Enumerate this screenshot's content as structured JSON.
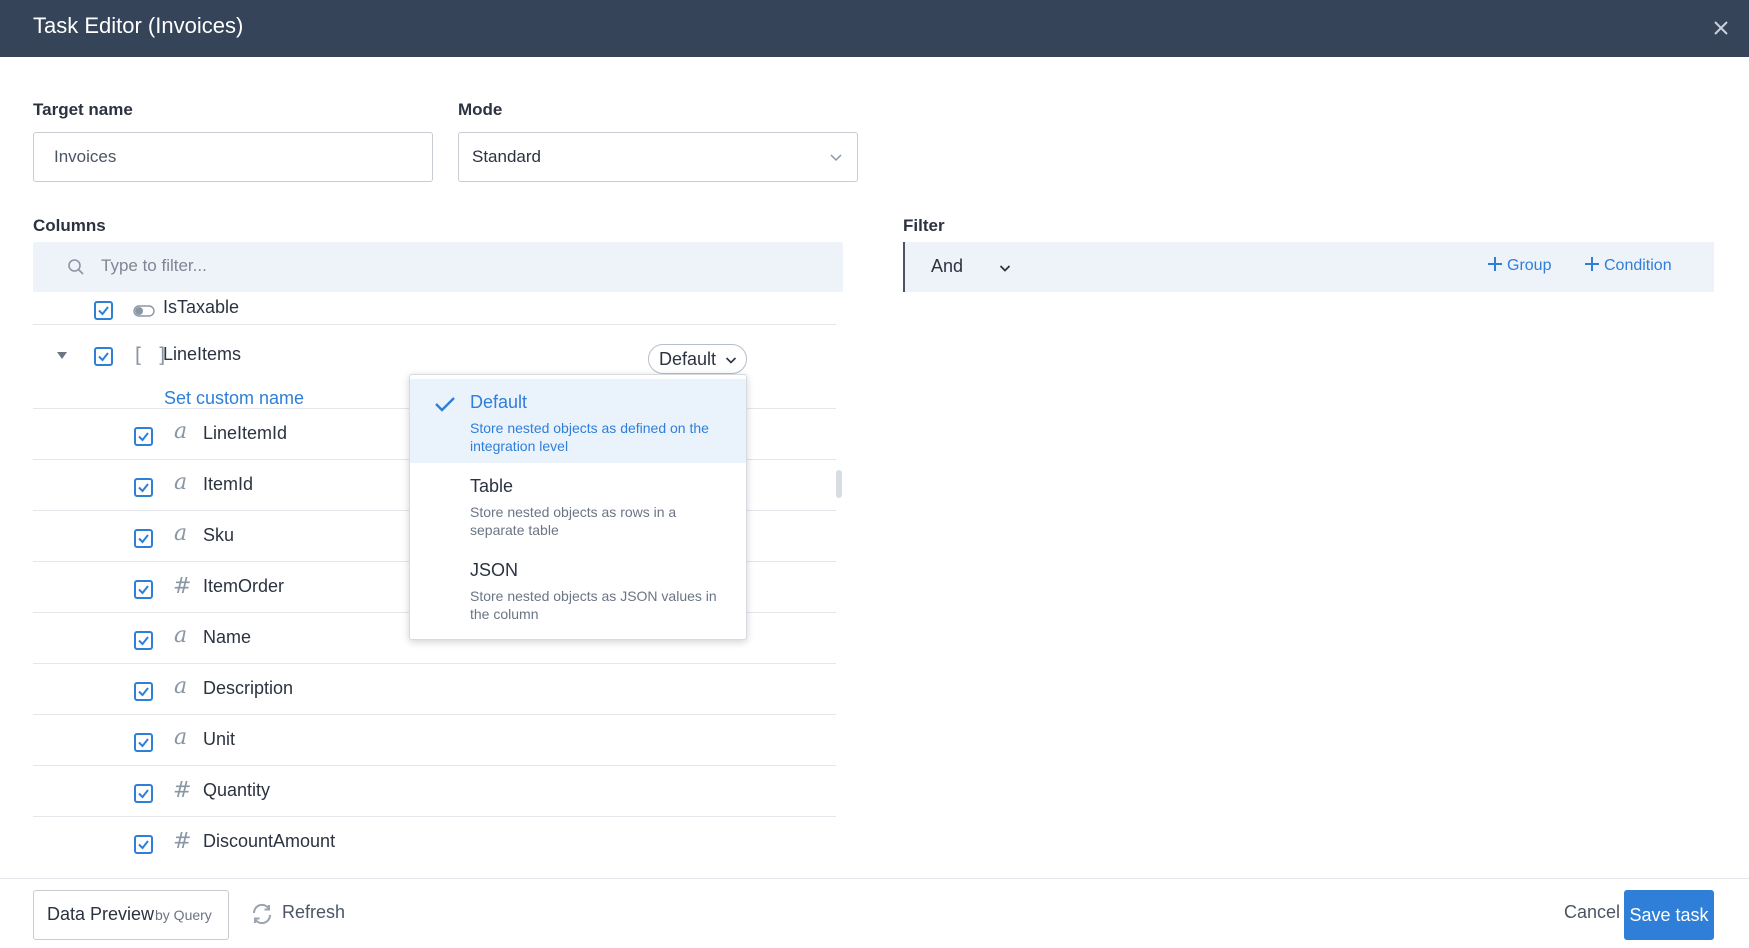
{
  "window": {
    "title": "Task Editor (Invoices)"
  },
  "target": {
    "label": "Target name",
    "value": "Invoices"
  },
  "mode": {
    "label": "Mode",
    "value": "Standard"
  },
  "columns": {
    "label": "Columns",
    "filter_placeholder": "Type to filter...",
    "rows": [
      {
        "name": "IsTaxable",
        "type": "boolean-icon",
        "checked": true
      },
      {
        "name": "LineItems",
        "type": "array-icon",
        "checked": true,
        "expanded": true,
        "mode": "Default",
        "custom_name_link": "Set custom name"
      },
      {
        "name": "LineItemId",
        "type": "text-icon",
        "checked": true
      },
      {
        "name": "ItemId",
        "type": "text-icon",
        "checked": true
      },
      {
        "name": "Sku",
        "type": "text-icon",
        "checked": true
      },
      {
        "name": "ItemOrder",
        "type": "number-icon",
        "checked": true
      },
      {
        "name": "Name",
        "type": "text-icon",
        "checked": true
      },
      {
        "name": "Description",
        "type": "text-icon",
        "checked": true
      },
      {
        "name": "Unit",
        "type": "text-icon",
        "checked": true
      },
      {
        "name": "Quantity",
        "type": "number-icon",
        "checked": true
      },
      {
        "name": "DiscountAmount",
        "type": "number-icon",
        "checked": true
      }
    ]
  },
  "nested_mode_dropdown": {
    "options": [
      {
        "name": "Default",
        "desc": "Store nested objects as defined on the integration level",
        "selected": true
      },
      {
        "name": "Table",
        "desc": "Store nested objects as rows in a separate table",
        "selected": false
      },
      {
        "name": "JSON",
        "desc": "Store nested objects as JSON values in the column",
        "selected": false
      }
    ]
  },
  "filter": {
    "label": "Filter",
    "operator": "And",
    "add_group": "Group",
    "add_condition": "Condition"
  },
  "footer": {
    "data_preview": "Data Preview",
    "data_preview_sub": "by Query",
    "refresh": "Refresh",
    "cancel": "Cancel",
    "save": "Save task"
  },
  "colors": {
    "header": "#354458",
    "accent": "#2f7fd8",
    "panel": "#eef3fa"
  }
}
